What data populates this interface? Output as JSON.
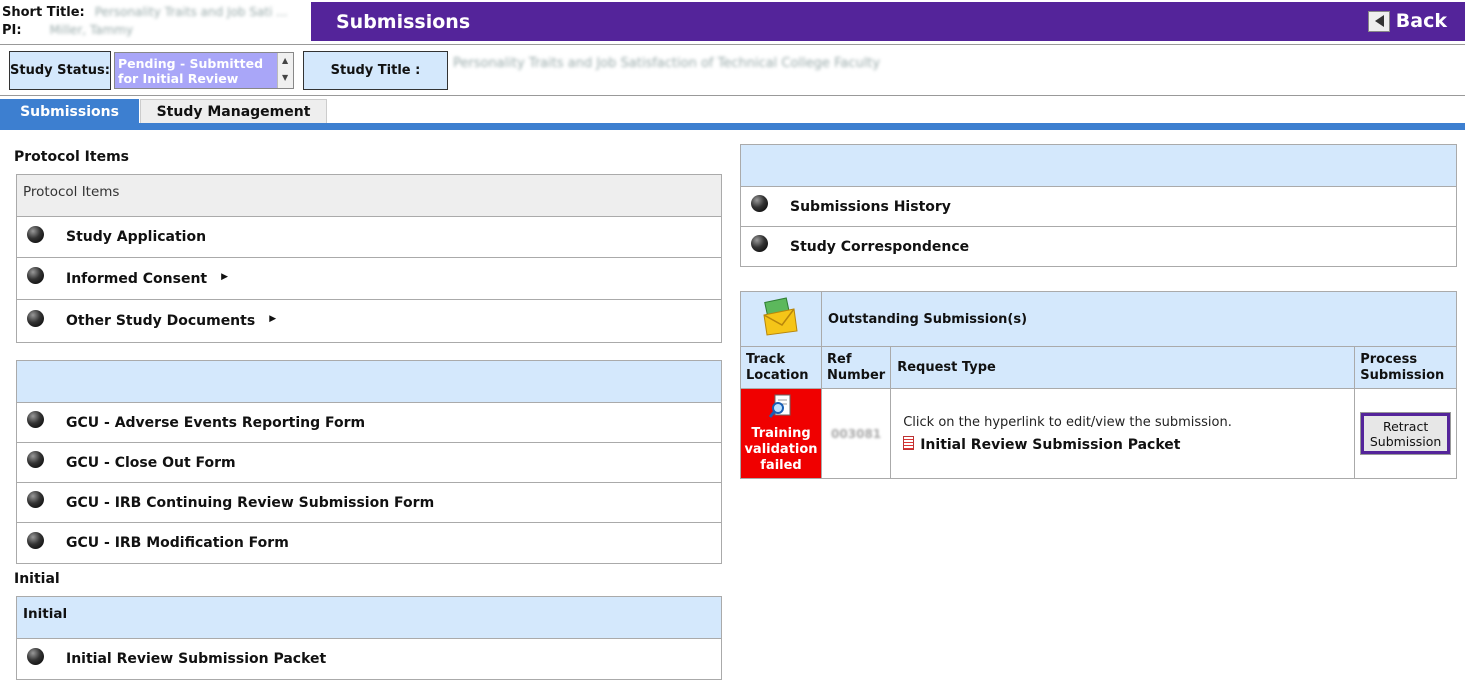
{
  "header": {
    "short_title_label": "Short Title:",
    "short_title_value": "Personality Traits and Job Sati ...",
    "pi_label": "PI:",
    "pi_value": "Miller, Tammy",
    "page_title": "Submissions",
    "back_label": "Back"
  },
  "status": {
    "study_status_label": "Study Status:",
    "study_status_value": "Pending - Submitted for Initial Review",
    "study_title_label": "Study Title :",
    "study_title_value": "Personality Traits and Job Satisfaction of Technical College Faculty"
  },
  "tabs": [
    {
      "label": "Submissions",
      "active": true
    },
    {
      "label": "Study Management",
      "active": false
    }
  ],
  "protocol": {
    "section_label": "Protocol Items",
    "panel_header": "Protocol Items",
    "items": [
      {
        "label": "Study Application"
      },
      {
        "label": "Informed Consent"
      },
      {
        "label": "Other Study Documents"
      }
    ]
  },
  "forms": {
    "panel_header": "",
    "items": [
      {
        "label": "GCU - Adverse Events Reporting Form"
      },
      {
        "label": "GCU - Close Out Form"
      },
      {
        "label": "GCU - IRB Continuing Review Submission Form"
      },
      {
        "label": "GCU - IRB Modification Form"
      }
    ]
  },
  "initial": {
    "section_label": "Initial",
    "panel_header": "Initial",
    "items": [
      {
        "label": "Initial Review Submission Packet"
      }
    ]
  },
  "right_panel": {
    "header": "",
    "items": [
      {
        "label": "Submissions History"
      },
      {
        "label": "Study Correspondence"
      }
    ]
  },
  "outstanding": {
    "title": "Outstanding Submission(s)",
    "columns": {
      "track": "Track Location",
      "ref": "Ref Number",
      "request": "Request Type",
      "process": "Process Submission"
    },
    "row": {
      "track_status": "Training validation failed",
      "ref_number": "003081",
      "hint": "Click on the hyperlink to edit/view the submission.",
      "packet": "Initial Review Submission Packet",
      "retract": "Retract Submission"
    }
  },
  "colors": {
    "header_purple": "#54249a",
    "tab_blue": "#3d7fd0",
    "light_blue": "#d4e8fc",
    "status_select": "#a9a6f8",
    "alert_red": "#f00000"
  }
}
